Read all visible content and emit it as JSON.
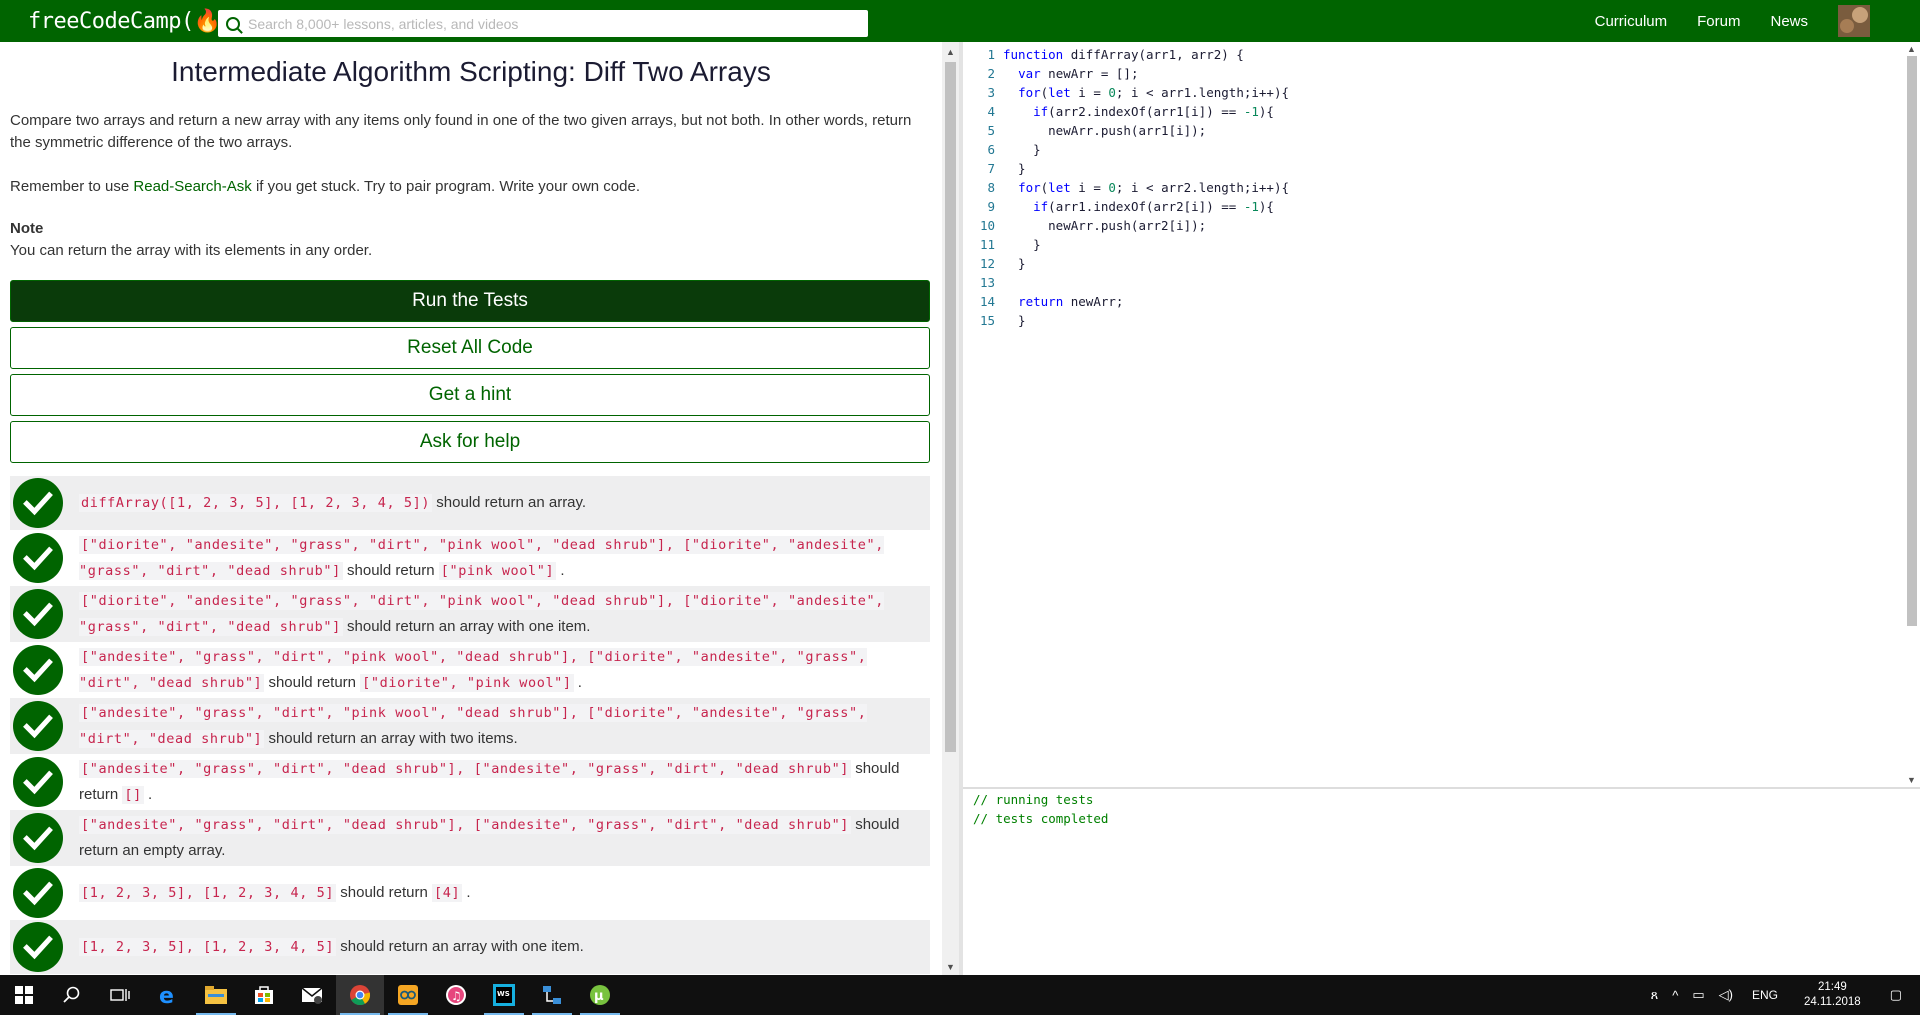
{
  "navbar": {
    "logo": "freeCodeCamp(🔥)",
    "search_placeholder": "Search 8,000+ lessons, articles, and videos",
    "links": [
      "Curriculum",
      "Forum",
      "News"
    ]
  },
  "challenge": {
    "title": "Intermediate Algorithm Scripting: Diff Two Arrays",
    "description": "Compare two arrays and return a new array with any items only found in one of the two given arrays, but not both. In other words, return the symmetric difference of the two arrays.",
    "remember_pre": "Remember to use ",
    "remember_link": "Read-Search-Ask",
    "remember_post": " if you get stuck. Try to pair program. Write your own code.",
    "note_heading": "Note",
    "note_text": "You can return the array with its elements in any order."
  },
  "buttons": {
    "run": "Run the Tests",
    "reset": "Reset All Code",
    "hint": "Get a hint",
    "help": "Ask for help"
  },
  "tests": [
    {
      "code": "diffArray([1, 2, 3, 5], [1, 2, 3, 4, 5])",
      "text": " should return an array.",
      "code2": "",
      "tail": ""
    },
    {
      "code": "[\"diorite\", \"andesite\", \"grass\", \"dirt\", \"pink wool\", \"dead shrub\"], [\"diorite\", \"andesite\", \"grass\", \"dirt\", \"dead shrub\"]",
      "text": " should return ",
      "code2": "[\"pink wool\"]",
      "tail": " ."
    },
    {
      "code": "[\"diorite\", \"andesite\", \"grass\", \"dirt\", \"pink wool\", \"dead shrub\"], [\"diorite\", \"andesite\", \"grass\", \"dirt\", \"dead shrub\"]",
      "text": " should return an array with one item.",
      "code2": "",
      "tail": ""
    },
    {
      "code": "[\"andesite\", \"grass\", \"dirt\", \"pink wool\", \"dead shrub\"], [\"diorite\", \"andesite\", \"grass\", \"dirt\", \"dead shrub\"]",
      "text": " should return ",
      "code2": "[\"diorite\", \"pink wool\"]",
      "tail": " ."
    },
    {
      "code": "[\"andesite\", \"grass\", \"dirt\", \"pink wool\", \"dead shrub\"], [\"diorite\", \"andesite\", \"grass\", \"dirt\", \"dead shrub\"]",
      "text": " should return an array with two items.",
      "code2": "",
      "tail": ""
    },
    {
      "code": "[\"andesite\", \"grass\", \"dirt\", \"dead shrub\"], [\"andesite\", \"grass\", \"dirt\", \"dead shrub\"]",
      "text": " should return ",
      "code2": "[]",
      "tail": " ."
    },
    {
      "code": "[\"andesite\", \"grass\", \"dirt\", \"dead shrub\"], [\"andesite\", \"grass\", \"dirt\", \"dead shrub\"]",
      "text": " should return an empty array.",
      "code2": "",
      "tail": ""
    },
    {
      "code": "[1, 2, 3, 5], [1, 2, 3, 4, 5]",
      "text": " should return ",
      "code2": "[4]",
      "tail": " ."
    },
    {
      "code": "[1, 2, 3, 5], [1, 2, 3, 4, 5]",
      "text": " should return an array with one item.",
      "code2": "",
      "tail": ""
    }
  ],
  "editor": {
    "lines": [
      "function diffArray(arr1, arr2) {",
      "  var newArr = [];",
      "  for(let i = 0; i < arr1.length;i++){",
      "    if(arr2.indexOf(arr1[i]) == -1){",
      "      newArr.push(arr1[i]);",
      "    }",
      "  }",
      "  for(let i = 0; i < arr2.length;i++){",
      "    if(arr1.indexOf(arr2[i]) == -1){",
      "      newArr.push(arr2[i]);",
      "    }",
      "  }",
      "",
      "  return newArr;",
      "  }"
    ]
  },
  "console": {
    "lines": [
      "// running tests",
      "// tests completed"
    ]
  },
  "taskbar": {
    "apps": [
      "start-icon",
      "search-icon",
      "task-view-icon",
      "edge-icon",
      "file-explorer-icon",
      "store-icon",
      "mail-icon",
      "chrome-icon",
      "arduino-icon",
      "itunes-icon",
      "webstorm-icon",
      "network-tool-icon",
      "utorrent-icon"
    ],
    "language": "ENG",
    "time": "21:49",
    "date": "24.11.2018"
  },
  "colors": {
    "brand_green": "#006400",
    "run_button_bg": "#0a3b0a",
    "code_red": "#c7254e"
  }
}
